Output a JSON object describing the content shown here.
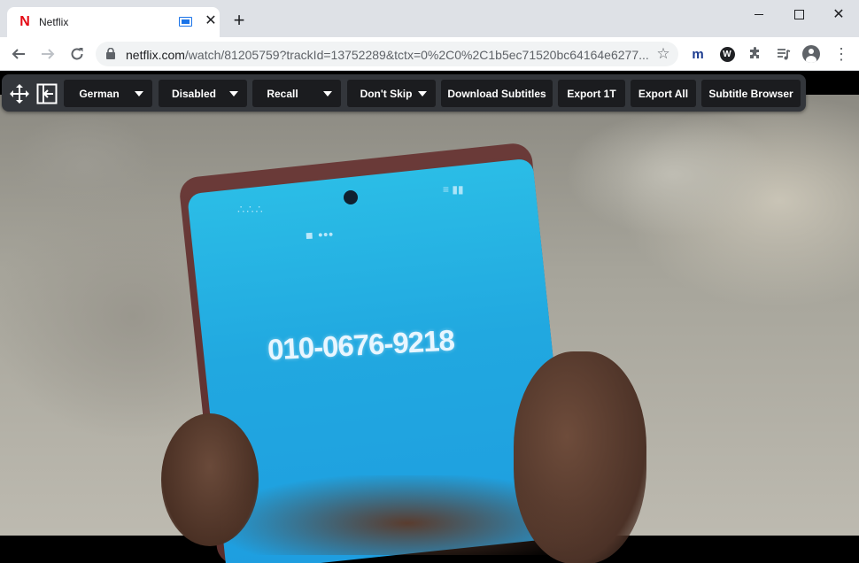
{
  "browser": {
    "tab": {
      "title": "Netflix",
      "favicon_letter": "N",
      "favicon_color": "#e50914"
    },
    "new_tab_symbol": "+",
    "url": {
      "domain": "netflix.com",
      "path": "/watch/81205759?trackId=13752289&tctx=0%2C0%2C1b5ec71520bc64164e6277..."
    },
    "extensions": {
      "m_label": "m",
      "w_label": "W"
    },
    "icons": [
      "back-icon",
      "forward-icon",
      "reload-icon",
      "lock-icon",
      "star-icon",
      "puzzle-icon",
      "media-icon",
      "profile-icon",
      "menu-icon"
    ]
  },
  "subtitle_toolbar": {
    "language": "German",
    "mode": "Disabled",
    "recall": "Recall",
    "skip": "Don't Skip",
    "download": "Download Subtitles",
    "export_one": "Export 1T",
    "export_all": "Export All",
    "browser": "Subtitle Browser"
  },
  "video": {
    "caller_number": "010-0676-9218",
    "caller_sub": "■ •••",
    "status_left": "∴∴∴",
    "status_right": "≡ ▮▮"
  },
  "colors": {
    "netflix_red": "#e50914",
    "toolbar_bg": "#33363b",
    "button_bg": "#1b1c1f",
    "phone_screen": "#21a8e0"
  }
}
